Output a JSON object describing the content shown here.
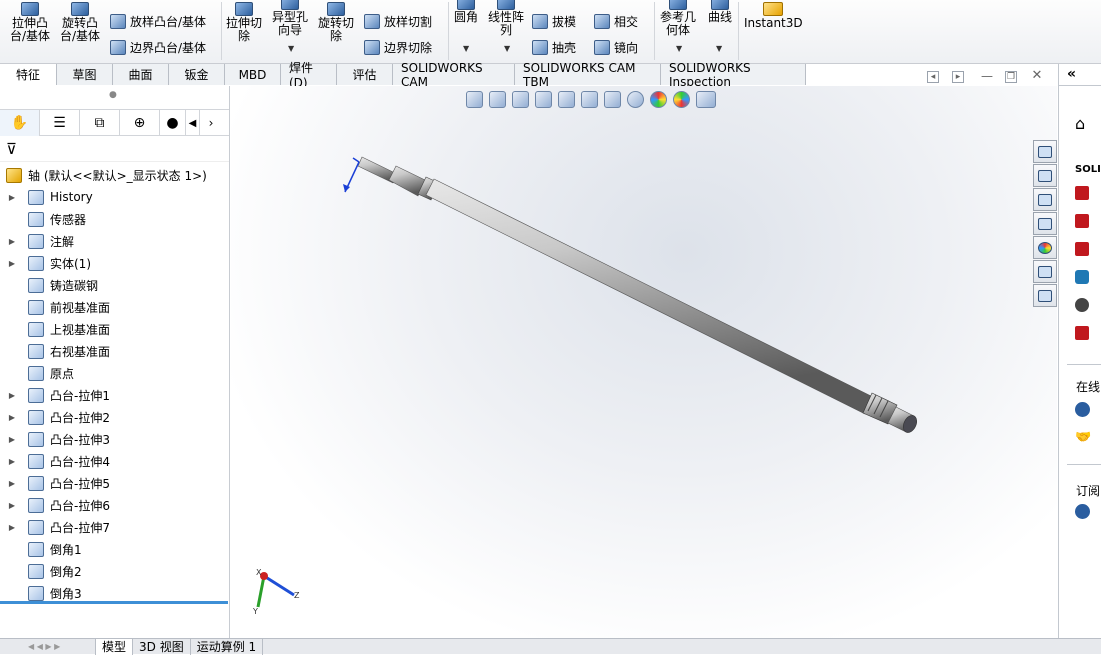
{
  "ribbon": {
    "b1": "拉伸凸\n台/基体",
    "b2": "旋转凸\n台/基体",
    "s1": "放样凸台/基体",
    "s2": "边界凸台/基体",
    "b3": "拉伸切\n除",
    "b4": "异型孔\n向导",
    "b5": "旋转切\n除",
    "s3": "放样切割",
    "s4": "边界切除",
    "b6": "圆角",
    "b7": "线性阵\n列",
    "s5": "拔模",
    "s6": "抽壳",
    "s7": "相交",
    "s8": "镜向",
    "b8": "参考几\n何体",
    "b9": "曲线",
    "b10": "Instant3D"
  },
  "tabs": [
    "特征",
    "草图",
    "曲面",
    "钣金",
    "MBD",
    "焊件(D)",
    "评估",
    "SOLIDWORKS CAM",
    "SOLIDWORKS CAM TBM",
    "SOLIDWORKS Inspection"
  ],
  "tree": {
    "root": "轴 (默认<<默认>_显示状态 1>)",
    "items": [
      "History",
      "传感器",
      "注解",
      "实体(1)",
      "铸造碳钢",
      "前视基准面",
      "上视基准面",
      "右视基准面",
      "原点",
      "凸台-拉伸1",
      "凸台-拉伸2",
      "凸台-拉伸3",
      "凸台-拉伸4",
      "凸台-拉伸5",
      "凸台-拉伸6",
      "凸台-拉伸7",
      "倒角1",
      "倒角2",
      "倒角3"
    ]
  },
  "task": {
    "solid": "SOLI",
    "online": "在线",
    "subscribe": "订阅"
  },
  "bottom_tabs": [
    "模型",
    "3D 视图",
    "运动算例 1"
  ],
  "triad": {
    "x": "X",
    "y": "Y",
    "z": "Z"
  }
}
